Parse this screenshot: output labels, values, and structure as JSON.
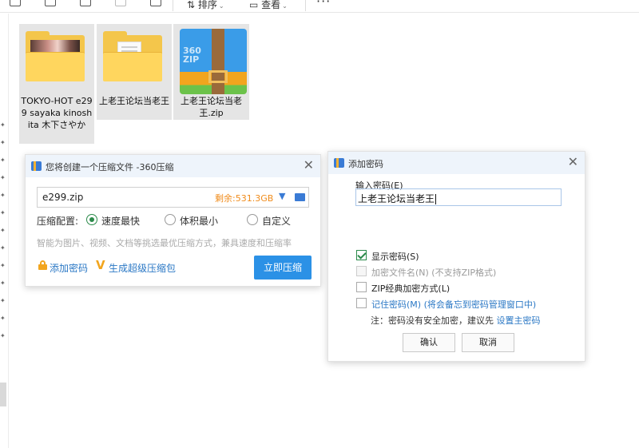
{
  "toolbar": {
    "sort_label": "排序",
    "view_label": "查看",
    "more_label": "···"
  },
  "files": [
    {
      "name": "TOKYO-HOT e299 sayaka kinoshita 木下さやか",
      "type": "folder-with-photo"
    },
    {
      "name": "上老王论坛当老王",
      "type": "folder"
    },
    {
      "name": "上老王论坛当老王.zip",
      "type": "zip",
      "zip_text": "360\nZIP"
    }
  ],
  "compress_dialog": {
    "title": "您将创建一个压缩文件 -360压缩",
    "path": "e299.zip",
    "free_space": "剩余:531.3GB",
    "config_label": "压缩配置:",
    "options": [
      "速度最快",
      "体积最小",
      "自定义"
    ],
    "selected_option": "速度最快",
    "hint": "智能为图片、视频、文档等挑选最优压缩方式，兼具速度和压缩率",
    "add_password_label": "添加密码",
    "super_package_label": "生成超级压缩包",
    "compress_button": "立即压缩",
    "close_label": "✕"
  },
  "password_dialog": {
    "title": "添加密码",
    "input_label": "输入密码(E)",
    "password_value": "上老王论坛当老王",
    "checkboxes": [
      {
        "label": "显示密码(S)",
        "checked": true,
        "disabled": false
      },
      {
        "label": "加密文件名(N) (不支持ZIP格式)",
        "checked": false,
        "disabled": true
      },
      {
        "label": "ZIP经典加密方式(L)",
        "checked": false,
        "disabled": false
      },
      {
        "label": "记住密码(M) (将会备忘到密码管理窗口中)",
        "checked": false,
        "disabled": false
      }
    ],
    "note_prefix": "注：密码没有安全加密，建议先 ",
    "note_link": "设置主密码",
    "ok_button": "确认",
    "cancel_button": "取消",
    "close_label": "✕"
  },
  "colors": {
    "accent_blue": "#2b91e6",
    "link_blue": "#2b78c5",
    "orange": "#f08c1c",
    "green_check": "#2b8a4a"
  }
}
